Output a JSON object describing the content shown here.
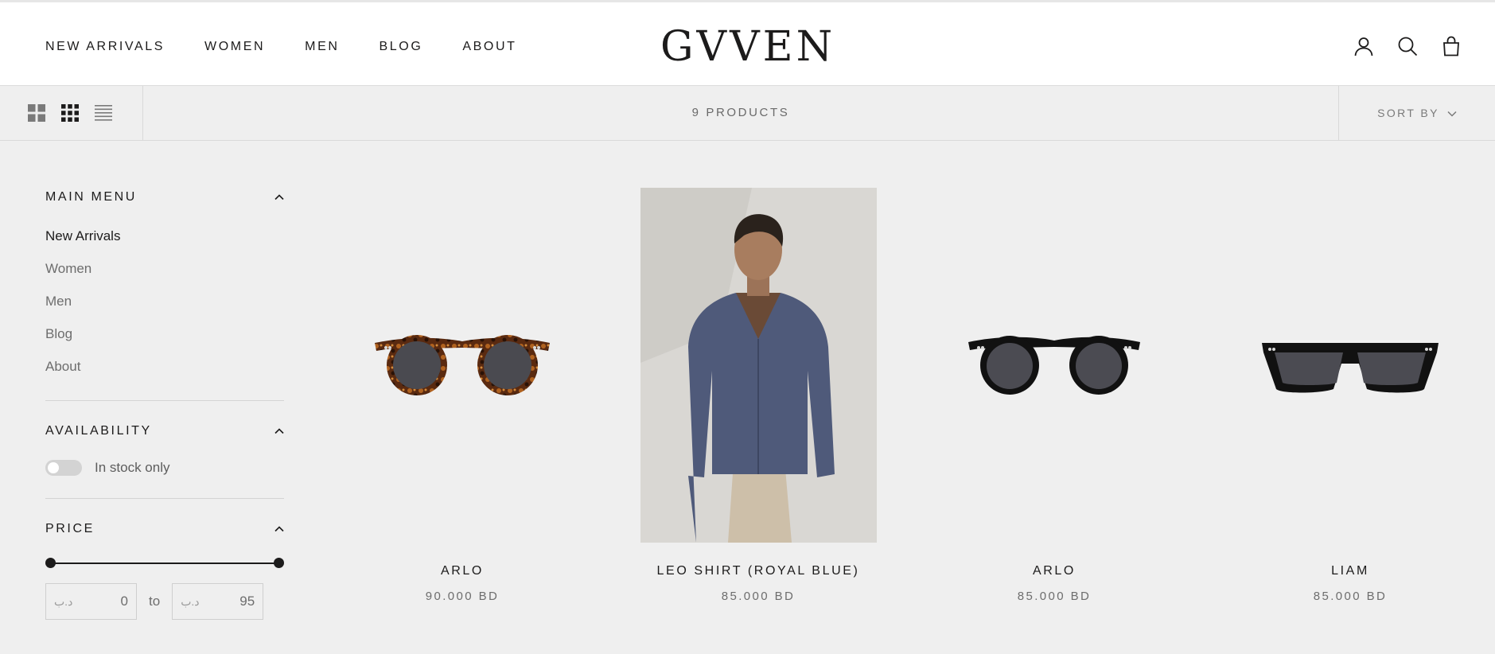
{
  "header": {
    "nav": [
      "NEW ARRIVALS",
      "WOMEN",
      "MEN",
      "BLOG",
      "ABOUT"
    ],
    "logo": "GVVEN",
    "icons": [
      "account-icon",
      "search-icon",
      "cart-icon"
    ]
  },
  "toolbar": {
    "layout_icons": [
      "grid-large-icon",
      "grid-small-icon",
      "list-icon"
    ],
    "product_count": "9 PRODUCTS",
    "sort_label": "SORT BY"
  },
  "sidebar": {
    "main_menu": {
      "title": "MAIN MENU",
      "items": [
        "New Arrivals",
        "Women",
        "Men",
        "Blog",
        "About"
      ],
      "active_index": 0
    },
    "availability": {
      "title": "AVAILABILITY",
      "toggle_label": "In stock only",
      "toggle_on": false
    },
    "price": {
      "title": "PRICE",
      "min": "0",
      "max": "95",
      "currency": "د.ب",
      "to_label": "to"
    }
  },
  "products": [
    {
      "title": "ARLO",
      "price": "90.000 BD",
      "image": "tortoise-round-sunglasses"
    },
    {
      "title": "LEO SHIRT (ROYAL BLUE)",
      "price": "85.000 BD",
      "image": "man-in-blue-linen-shirt"
    },
    {
      "title": "ARLO",
      "price": "85.000 BD",
      "image": "black-round-sunglasses"
    },
    {
      "title": "LIAM",
      "price": "85.000 BD",
      "image": "black-square-sunglasses"
    }
  ],
  "colors": {
    "page_bg": "#efefef",
    "header_bg": "#ffffff",
    "text": "#1c1b1b",
    "muted": "#6d6d6d"
  }
}
